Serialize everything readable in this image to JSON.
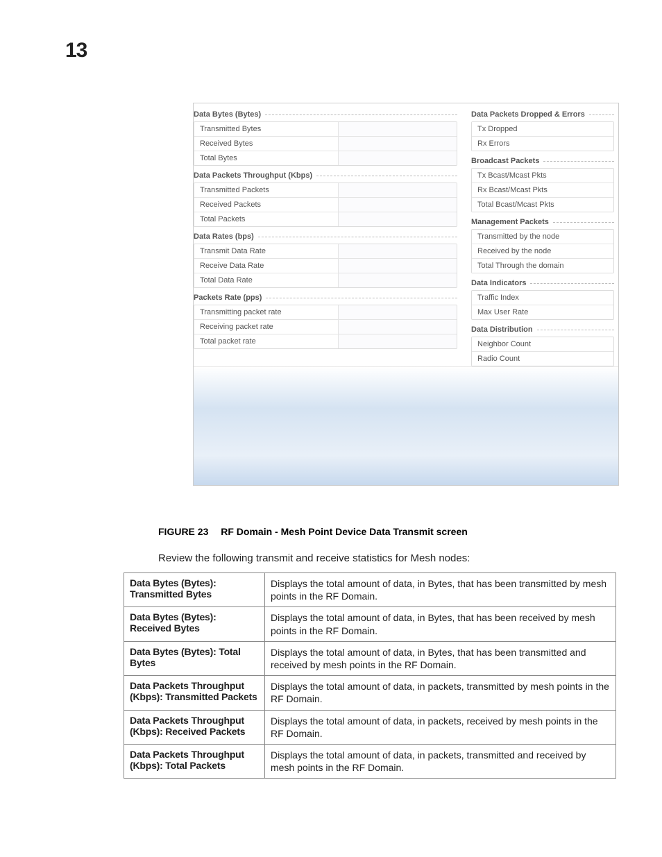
{
  "page_number": "13",
  "screenshot": {
    "left": {
      "sections": [
        {
          "title": "Data Bytes (Bytes)",
          "rows": [
            "Transmitted Bytes",
            "Received Bytes",
            "Total Bytes"
          ]
        },
        {
          "title": "Data Packets Throughput (Kbps)",
          "rows": [
            "Transmitted Packets",
            "Received Packets",
            "Total Packets"
          ]
        },
        {
          "title": "Data Rates (bps)",
          "rows": [
            "Transmit Data Rate",
            "Receive Data Rate",
            "Total Data Rate"
          ]
        },
        {
          "title": "Packets Rate (pps)",
          "rows": [
            "Transmitting packet rate",
            "Receiving packet rate",
            "Total packet rate"
          ]
        }
      ]
    },
    "right": {
      "sections": [
        {
          "title": "Data Packets Dropped & Errors",
          "rows": [
            "Tx Dropped",
            "Rx Errors"
          ]
        },
        {
          "title": "Broadcast Packets",
          "rows": [
            "Tx Bcast/Mcast Pkts",
            "Rx Bcast/Mcast Pkts",
            "Total Bcast/Mcast Pkts"
          ]
        },
        {
          "title": "Management Packets",
          "rows": [
            "Transmitted by the node",
            "Received by the node",
            "Total Through the domain"
          ]
        },
        {
          "title": "Data Indicators",
          "rows": [
            "Traffic Index",
            "Max User Rate"
          ]
        },
        {
          "title": "Data Distribution",
          "rows": [
            "Neighbor Count",
            "Radio Count"
          ]
        }
      ]
    }
  },
  "caption": {
    "label": "FIGURE 23",
    "title": "RF Domain - Mesh Point Device Data Transmit screen"
  },
  "review_line": "Review the following transmit and receive statistics for Mesh nodes:",
  "definitions": [
    {
      "term": "Data Bytes (Bytes): Transmitted Bytes",
      "desc": "Displays the total amount of data, in Bytes, that has been transmitted by mesh points in the RF Domain."
    },
    {
      "term": "Data Bytes (Bytes): Received Bytes",
      "desc": "Displays the total amount of data, in Bytes, that has been received by mesh points in the RF Domain."
    },
    {
      "term": "Data Bytes (Bytes): Total Bytes",
      "desc": "Displays the total amount of data, in Bytes, that has been transmitted and received by mesh points in the RF Domain."
    },
    {
      "term": "Data Packets Throughput (Kbps): Transmitted Packets",
      "desc": "Displays the total amount of data, in packets, transmitted by mesh points in the RF Domain."
    },
    {
      "term": "Data Packets Throughput (Kbps): Received Packets",
      "desc": "Displays the total amount of data, in packets, received by mesh points in the RF Domain."
    },
    {
      "term": "Data Packets Throughput (Kbps): Total Packets",
      "desc": "Displays the total amount of data, in packets, transmitted and received by mesh points in the RF Domain."
    }
  ]
}
